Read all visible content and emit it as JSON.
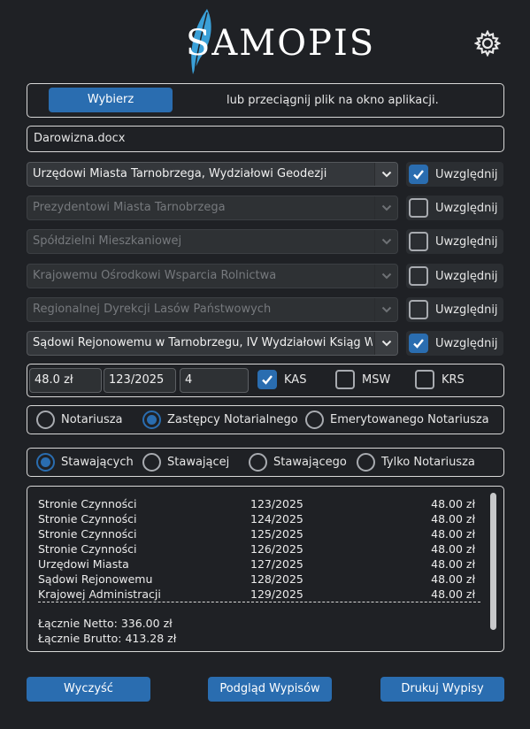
{
  "app": {
    "logo_text": "SAMOPIS"
  },
  "file": {
    "choose_label": "Wybierz",
    "drop_hint": "lub przeciągnij plik na okno aplikacji.",
    "filename": "Darowizna.docx"
  },
  "recipients": [
    {
      "label": "Urzędowi Miasta Tarnobrzega, Wydziałowi Geodezji",
      "enabled": true,
      "checked": true,
      "check_label": "Uwzględnij"
    },
    {
      "label": "Prezydentowi Miasta Tarnobrzega",
      "enabled": false,
      "checked": false,
      "check_label": "Uwzględnij"
    },
    {
      "label": "Spółdzielni Mieszkaniowej",
      "enabled": false,
      "checked": false,
      "check_label": "Uwzględnij"
    },
    {
      "label": "Krajowemu Ośrodkowi Wsparcia Rolnictwa",
      "enabled": false,
      "checked": false,
      "check_label": "Uwzględnij"
    },
    {
      "label": "Regionalnej Dyrekcji Lasów Państwowych",
      "enabled": false,
      "checked": false,
      "check_label": "Uwzględnij"
    },
    {
      "label": "Sądowi Rejonowemu w Tarnobrzegu, IV Wydziałowi Ksiąg Wieczystych",
      "enabled": true,
      "checked": true,
      "check_label": "Uwzględnij"
    }
  ],
  "params": {
    "price": "48.0 zł",
    "number": "123/2025",
    "count": "4",
    "kas_label": "KAS",
    "kas_checked": true,
    "msw_label": "MSW",
    "msw_checked": false,
    "krs_label": "KRS",
    "krs_checked": false
  },
  "role": {
    "options": [
      "Notariusza",
      "Zastępcy Notarialnego",
      "Emerytowanego Notariusza"
    ],
    "selected": 1
  },
  "party": {
    "options": [
      "Stawających",
      "Stawającej",
      "Stawającego",
      "Tylko Notariusza"
    ],
    "selected": 0
  },
  "summary": {
    "rows": [
      {
        "name": "Stronie Czynności",
        "number": "123/2025",
        "amount": "48.00 zł"
      },
      {
        "name": "Stronie Czynności",
        "number": "124/2025",
        "amount": "48.00 zł"
      },
      {
        "name": "Stronie Czynności",
        "number": "125/2025",
        "amount": "48.00 zł"
      },
      {
        "name": "Stronie Czynności",
        "number": "126/2025",
        "amount": "48.00 zł"
      },
      {
        "name": "Urzędowi Miasta",
        "number": "127/2025",
        "amount": "48.00 zł"
      },
      {
        "name": "Sądowi Rejonowemu",
        "number": "128/2025",
        "amount": "48.00 zł"
      },
      {
        "name": "Krajowej Administracji",
        "number": "129/2025",
        "amount": "48.00 zł"
      }
    ],
    "separator": "----------------------------------------------------------------------------------------------------",
    "net": "Łącznie Netto: 336.00 zł",
    "gross": "Łącznie Brutto: 413.28 zł"
  },
  "actions": {
    "clear_label": "Wyczyść",
    "preview_label": "Podgląd Wypisów",
    "print_label": "Drukuj Wypisy"
  },
  "colors": {
    "accent": "#2a6db0",
    "background": "#1f2125"
  }
}
